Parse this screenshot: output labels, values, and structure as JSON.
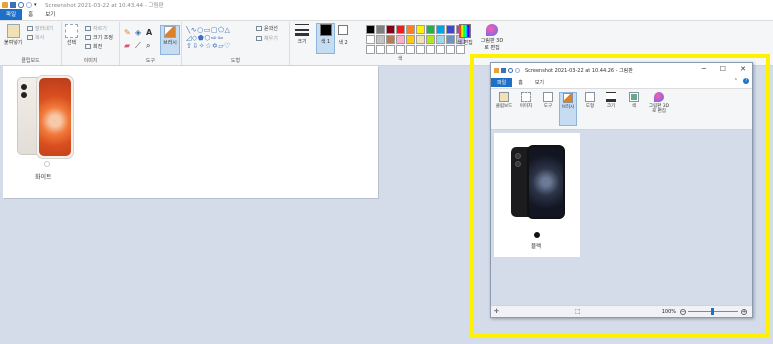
{
  "app": {
    "title": "Screenshot 2021-03-22 at 10.43.44 - 그림판"
  },
  "tabs": [
    {
      "label": "파일"
    },
    {
      "label": "홈"
    },
    {
      "label": "보기"
    }
  ],
  "ribbon": {
    "clipboard": {
      "label": "클립보드",
      "paste": "붙여넣기",
      "cut": "잘라내기",
      "copy": "복사"
    },
    "image": {
      "label": "이미지",
      "select": "선택",
      "crop": "자르기",
      "resize": "크기 조정",
      "rotate": "회전"
    },
    "tools": {
      "label": "도구",
      "brush": "브러시"
    },
    "shapes": {
      "label": "도형",
      "outline": "윤곽선",
      "fill": "채우기"
    },
    "size": {
      "label": "크기"
    },
    "color1": {
      "label": "색 1"
    },
    "color2": {
      "label": "색 2"
    },
    "colors": {
      "label": "색"
    },
    "edit_colors": "색 편집",
    "paint3d": "그림판 3D로 편집"
  },
  "palette": [
    "#000000",
    "#7f7f7f",
    "#880015",
    "#ed1c24",
    "#ff7f27",
    "#fff200",
    "#22b14c",
    "#00a2e8",
    "#3f48cc",
    "#a349a4",
    "#ffffff",
    "#c3c3c3",
    "#b97a57",
    "#ffaec9",
    "#ffc90e",
    "#efe4b0",
    "#b5e61d",
    "#99d9ea",
    "#7092be",
    "#c8bfe7",
    "#ffffff",
    "#ffffff",
    "#ffffff",
    "#ffffff",
    "#ffffff",
    "#ffffff",
    "#ffffff",
    "#ffffff",
    "#ffffff",
    "#ffffff"
  ],
  "canvas": {
    "product_color_label": "화이트"
  },
  "second_window": {
    "title": "Screenshot 2021-03-22 at 10.44.26 - 그림판",
    "tabs": [
      {
        "label": "파일"
      },
      {
        "label": "홈"
      },
      {
        "label": "보기"
      }
    ],
    "ribbon_buttons": [
      {
        "label": "클립보드"
      },
      {
        "label": "이미지"
      },
      {
        "label": "도구"
      },
      {
        "label": "브러시"
      },
      {
        "label": "도형"
      },
      {
        "label": "크기"
      },
      {
        "label": "색"
      },
      {
        "label": "그림판 3D로 편집"
      }
    ],
    "product_color_label": "블랙",
    "status": {
      "zoom": "100%"
    }
  }
}
